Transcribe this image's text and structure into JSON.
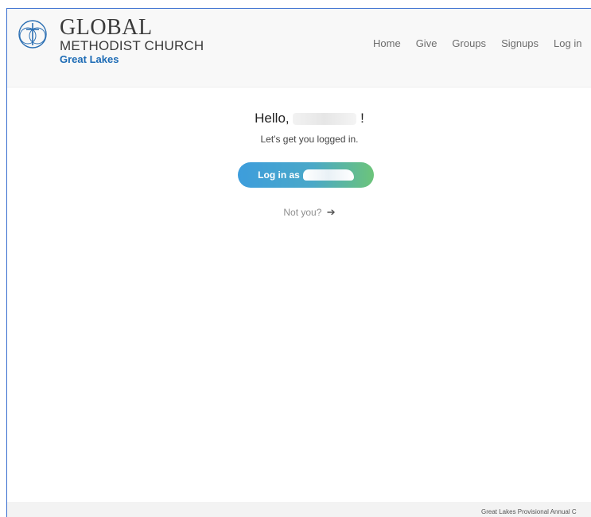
{
  "header": {
    "brand": {
      "line1": "GLOBAL",
      "line2": "METHODIST CHURCH",
      "line3": "Great Lakes",
      "logo_icon": "cross-circle-logo-icon"
    },
    "nav": [
      {
        "label": "Home"
      },
      {
        "label": "Give"
      },
      {
        "label": "Groups"
      },
      {
        "label": "Signups"
      },
      {
        "label": "Log in"
      }
    ]
  },
  "main": {
    "greeting_prefix": "Hello,",
    "greeting_suffix": "!",
    "subtitle": "Let's get you logged in.",
    "login_button_label": "Log in as",
    "not_you_label": "Not you?",
    "not_you_icon": "arrow-right-icon"
  },
  "footer": {
    "text": "Great Lakes Provisional Annual C"
  },
  "colors": {
    "brand_blue": "#1d6bb5",
    "button_gradient_start": "#3d9ddc",
    "button_gradient_end": "#6cc47a",
    "frame_border": "#3a6fd0"
  }
}
